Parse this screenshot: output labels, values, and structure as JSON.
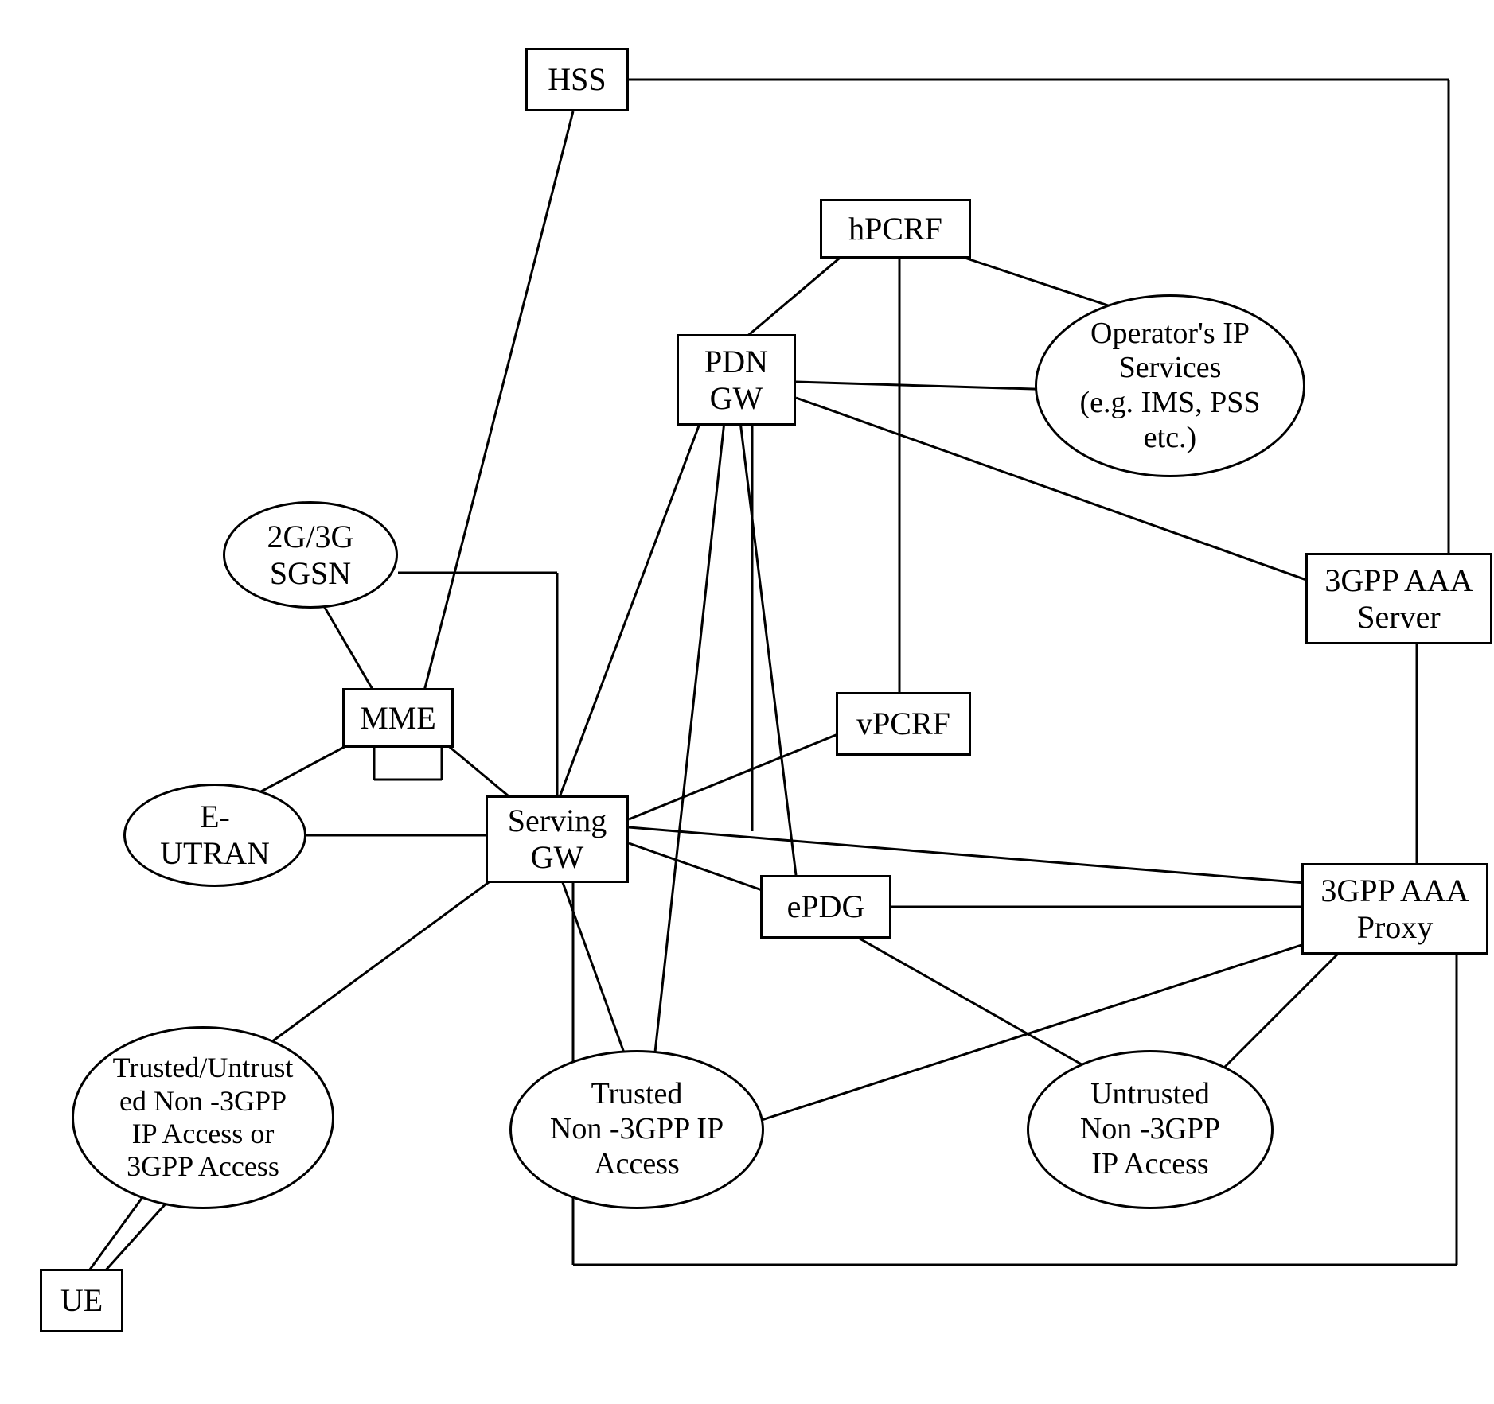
{
  "nodes": {
    "hss": "HSS",
    "hpcrf": "hPCRF",
    "opip": "Operator's IP\nServices\n(e.g. IMS, PSS\netc.)",
    "pdngw": "PDN\nGW",
    "sgsn": "2G/3G\nSGSN",
    "aaaserver": "3GPP AAA\nServer",
    "mme": "MME",
    "vpcrf": "vPCRF",
    "eutran": "E-\nUTRAN",
    "sgw": "Serving\nGW",
    "epdg": "ePDG",
    "aaaproxy": "3GPP AAA\nProxy",
    "trusteduntrusted": "Trusted/Untrust\ned  Non -3GPP\nIP Access or\n3GPP Access",
    "trusted": "Trusted\nNon -3GPP IP\nAccess",
    "untrusted": "Untrusted\nNon -3GPP\nIP Access",
    "ue": "UE"
  }
}
